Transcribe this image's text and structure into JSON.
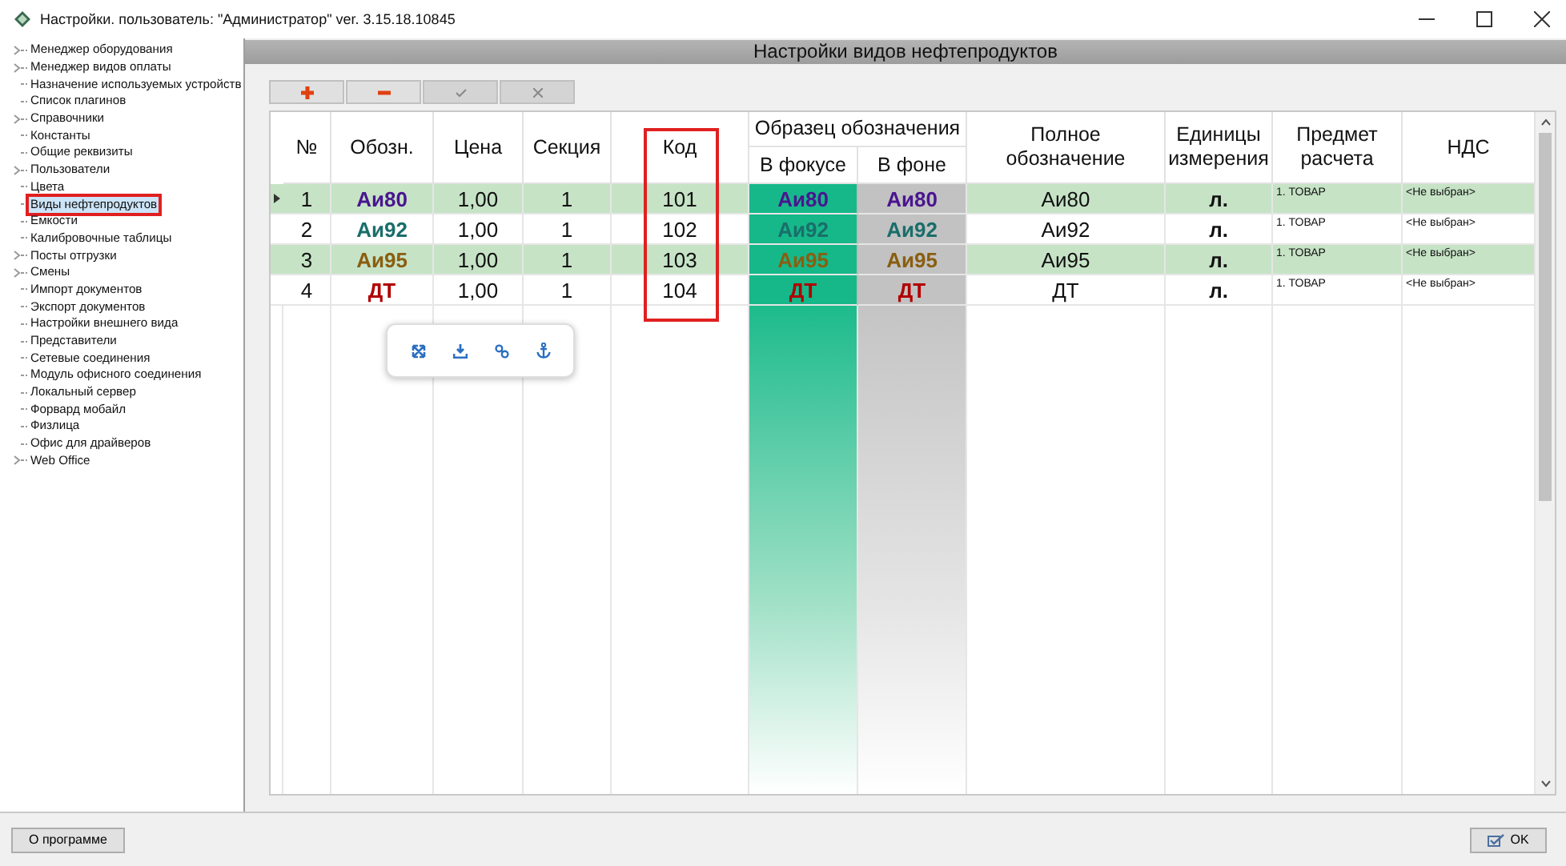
{
  "window": {
    "title": "Настройки. пользователь: \"Администратор\" ver. 3.15.18.10845"
  },
  "sidebar": {
    "items": [
      {
        "label": "Менеджер оборудования",
        "kind": "branch",
        "selected": false
      },
      {
        "label": "Менеджер видов оплаты",
        "kind": "branch",
        "selected": false
      },
      {
        "label": "Назначение используемых устройств",
        "kind": "leaf",
        "selected": false
      },
      {
        "label": "Список плагинов",
        "kind": "leaf",
        "selected": false
      },
      {
        "label": "Справочники",
        "kind": "branch",
        "selected": false
      },
      {
        "label": "Константы",
        "kind": "leaf",
        "selected": false
      },
      {
        "label": "Общие реквизиты",
        "kind": "leaf",
        "selected": false
      },
      {
        "label": "Пользователи",
        "kind": "branch",
        "selected": false
      },
      {
        "label": "Цвета",
        "kind": "leaf",
        "selected": false
      },
      {
        "label": "Виды нефтепродуктов",
        "kind": "leaf",
        "selected": true
      },
      {
        "label": "Емкости",
        "kind": "leaf",
        "selected": false
      },
      {
        "label": "Калибровочные таблицы",
        "kind": "leaf",
        "selected": false
      },
      {
        "label": "Посты отгрузки",
        "kind": "branch",
        "selected": false
      },
      {
        "label": "Смены",
        "kind": "branch",
        "selected": false
      },
      {
        "label": "Импорт документов",
        "kind": "leaf",
        "selected": false
      },
      {
        "label": "Экспорт документов",
        "kind": "leaf",
        "selected": false
      },
      {
        "label": "Настройки внешнего вида",
        "kind": "leaf",
        "selected": false
      },
      {
        "label": "Представители",
        "kind": "leaf",
        "selected": false
      },
      {
        "label": "Сетевые соединения",
        "kind": "leaf",
        "selected": false
      },
      {
        "label": "Модуль офисного соединения",
        "kind": "leaf",
        "selected": false
      },
      {
        "label": "Локальный сервер",
        "kind": "leaf",
        "selected": false
      },
      {
        "label": "Форвард мобайл",
        "kind": "leaf",
        "selected": false
      },
      {
        "label": "Физлица",
        "kind": "leaf",
        "selected": false
      },
      {
        "label": "Офис для драйверов",
        "kind": "leaf",
        "selected": false
      },
      {
        "label": "Web Office",
        "kind": "branch",
        "selected": false
      }
    ]
  },
  "panel": {
    "title": "Настройки видов нефтепродуктов",
    "toolbar": [
      {
        "kind": "add",
        "disabled": false
      },
      {
        "kind": "remove",
        "disabled": false
      },
      {
        "kind": "apply",
        "disabled": true
      },
      {
        "kind": "cancel",
        "disabled": true
      }
    ],
    "table": {
      "columns": [
        {
          "label": "№",
          "outlined": false
        },
        {
          "label": "Обозн.",
          "outlined": false
        },
        {
          "label": "Цена",
          "outlined": false
        },
        {
          "label": "Секция",
          "outlined": false
        },
        {
          "label": "Код",
          "outlined": true
        }
      ],
      "sample_group": {
        "label": "Образец обозначения",
        "columns": [
          "В фокусе",
          "В фоне"
        ]
      },
      "columns_after": [
        "Полное обозначение",
        "Единицы измерения",
        "Предмет расчета",
        "НДС"
      ],
      "rows": [
        {
          "number": "1",
          "short": "Аи80",
          "color": "#4a1590",
          "price": "1,00",
          "section": "1",
          "code": "101",
          "in_focus": "Аи80",
          "in_background": "Аи80",
          "full": "Аи80",
          "unit": "л.",
          "subject": "1. ТОВАР",
          "vat": "<Не выбран>",
          "selected": true
        },
        {
          "number": "2",
          "short": "Аи92",
          "color": "#1a6e6a",
          "price": "1,00",
          "section": "1",
          "code": "102",
          "in_focus": "Аи92",
          "in_background": "Аи92",
          "full": "Аи92",
          "unit": "л.",
          "subject": "1. ТОВАР",
          "vat": "<Не выбран>",
          "selected": false
        },
        {
          "number": "3",
          "short": "Аи95",
          "color": "#8a5e10",
          "price": "1,00",
          "section": "1",
          "code": "103",
          "in_focus": "Аи95",
          "in_background": "Аи95",
          "full": "Аи95",
          "unit": "л.",
          "subject": "1. ТОВАР",
          "vat": "<Не выбран>",
          "selected": false
        },
        {
          "number": "4",
          "short": "ДТ",
          "color": "#b00000",
          "price": "1,00",
          "section": "1",
          "code": "104",
          "in_focus": "ДТ",
          "in_background": "ДТ",
          "full": "ДТ",
          "unit": "л.",
          "subject": "1. ТОВАР",
          "vat": "<Не выбран>",
          "selected": false
        }
      ]
    }
  },
  "buttons": [
    {
      "label": "О программе",
      "kind": "about"
    },
    {
      "label": "OK",
      "kind": "ok"
    }
  ]
}
